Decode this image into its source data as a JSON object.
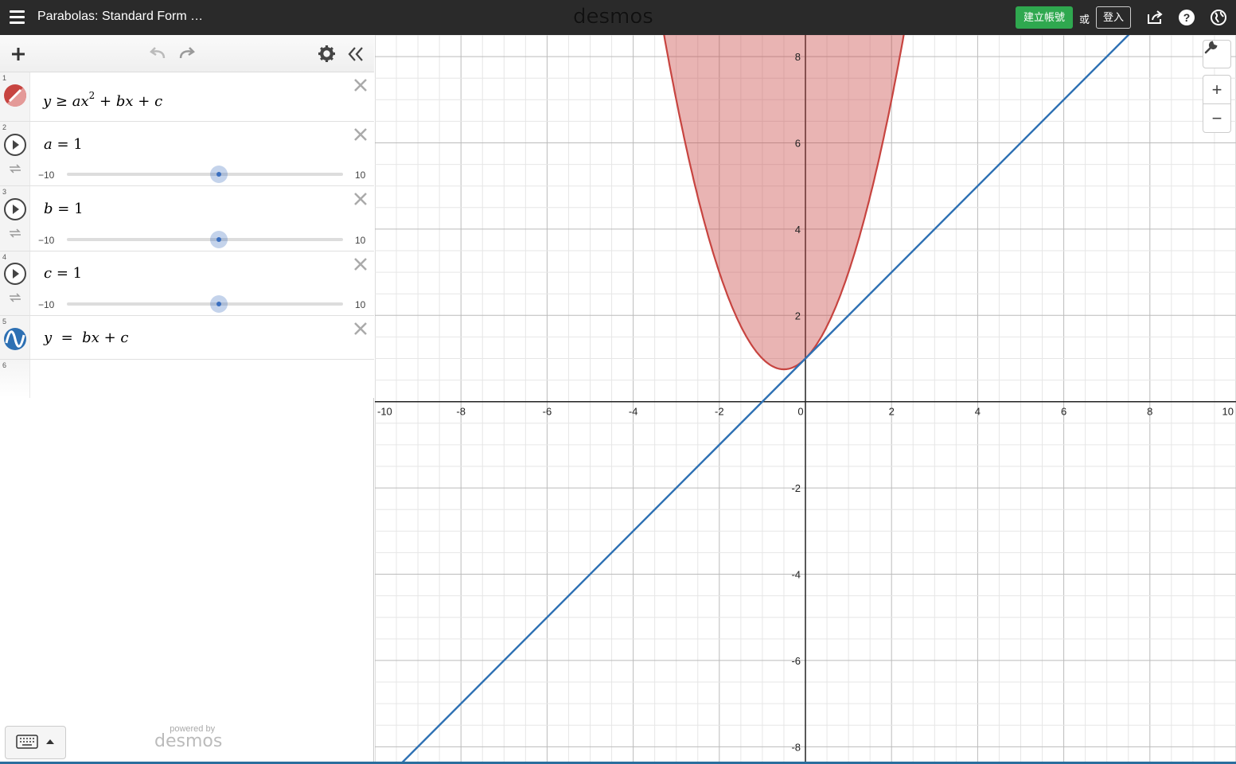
{
  "header": {
    "title": "Parabolas: Standard Form …",
    "logo": "desmos",
    "create_account": "建立帳號",
    "or": "或",
    "login": "登入",
    "icons": [
      "menu-icon",
      "share-icon",
      "help-icon",
      "globe-icon"
    ]
  },
  "panel": {
    "toolbar_icons": [
      "add-icon",
      "undo-icon",
      "redo-icon",
      "settings-icon",
      "collapse-icon"
    ],
    "expressions": [
      {
        "num": "1",
        "type": "inequality",
        "color": "#c74440",
        "latex_parts": [
          "y",
          "≥",
          "ax",
          "2",
          "+",
          "bx",
          "+",
          "c"
        ]
      },
      {
        "num": "2",
        "type": "slider",
        "var": "a",
        "eq": "=",
        "value": "1",
        "min": "−10",
        "max": "10",
        "fraction": 0.55
      },
      {
        "num": "3",
        "type": "slider",
        "var": "b",
        "eq": "=",
        "value": "1",
        "min": "−10",
        "max": "10",
        "fraction": 0.55
      },
      {
        "num": "4",
        "type": "slider",
        "var": "c",
        "eq": "=",
        "value": "1",
        "min": "−10",
        "max": "10",
        "fraction": 0.55
      },
      {
        "num": "5",
        "type": "line",
        "color": "#2d70b3",
        "latex_parts": [
          "y",
          "=",
          "bx",
          "+",
          "c"
        ]
      },
      {
        "num": "6",
        "type": "empty"
      }
    ],
    "powered_by": "powered by",
    "powered_logo": "desmos"
  },
  "graph": {
    "x_ticks": [
      "-10",
      "-8",
      "-6",
      "-4",
      "-2",
      "0",
      "2",
      "4",
      "6",
      "8",
      "10"
    ],
    "y_ticks": [
      "8",
      "6",
      "4",
      "2",
      "-2",
      "-4",
      "-6",
      "-8"
    ],
    "xlim": [
      -10,
      10
    ],
    "ylim": [
      -8.4,
      8.5
    ],
    "parabola": {
      "a": 1,
      "b": 1,
      "c": 1,
      "fill": "#c74440"
    },
    "line": {
      "m": 1,
      "c": 1,
      "color": "#2d70b3"
    },
    "zoom_in": "+",
    "zoom_out": "−"
  }
}
